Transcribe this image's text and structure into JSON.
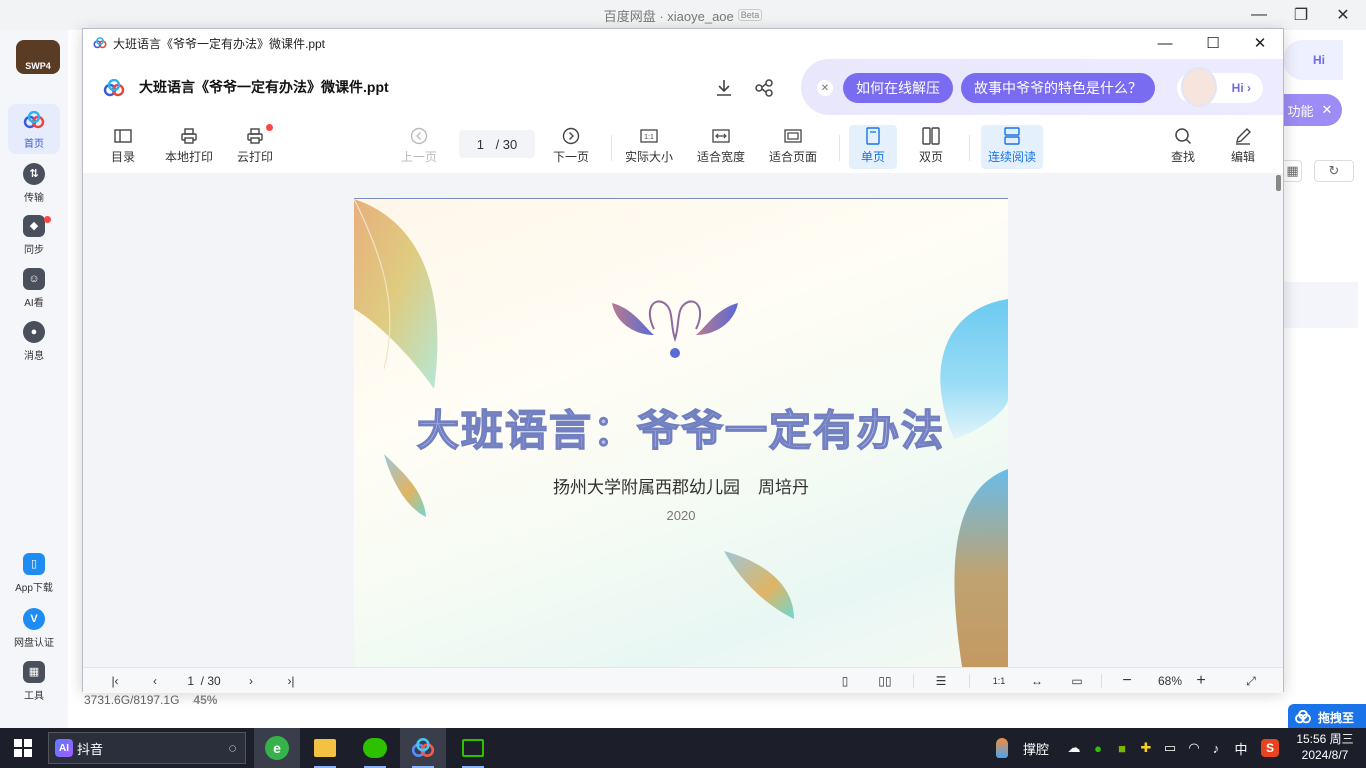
{
  "background_app": {
    "title": "百度网盘 · xiaoye_aoe",
    "beta_label": "Beta",
    "logo_text": "SWP4",
    "sidebar": [
      {
        "label": "首页",
        "icon": "cloud-icon"
      },
      {
        "label": "传输",
        "icon": "transfer-icon"
      },
      {
        "label": "同步",
        "icon": "sync-icon"
      },
      {
        "label": "AI看",
        "icon": "ai-watch-icon"
      },
      {
        "label": "消息",
        "icon": "message-icon"
      },
      {
        "label": "App下载",
        "icon": "phone-icon"
      },
      {
        "label": "网盘认证",
        "icon": "verify-icon"
      },
      {
        "label": "工具",
        "icon": "tools-icon"
      }
    ],
    "storage_text": "3731.6G/8197.1G",
    "storage_percent": "45%",
    "feature_pill_label": "功能",
    "hi_label": "Hi",
    "drag_pill_label": "拖拽至"
  },
  "viewer": {
    "window_title": "大班语言《爷爷一定有办法》微课件.ppt",
    "file_name": "大班语言《爷爷一定有办法》微课件.ppt",
    "ai_assistant": {
      "chips": [
        "如何在线解压",
        "故事中爷爷的特色是什么？"
      ],
      "hi_label": "Hi"
    },
    "toolbar": {
      "toc": "目录",
      "local_print": "本地打印",
      "cloud_print": "云打印",
      "prev_page": "上一页",
      "current_page": "1",
      "total_pages": "/ 30",
      "next_page": "下一页",
      "actual_size": "实际大小",
      "fit_width": "适合宽度",
      "fit_page": "适合页面",
      "single_page": "单页",
      "double_page": "双页",
      "continuous": "连续阅读",
      "find": "查找",
      "edit": "编辑"
    },
    "slide": {
      "title": "大班语言：爷爷一定有办法",
      "school": "扬州大学附属西郡幼儿园",
      "author": "周培丹",
      "year": "2020"
    },
    "statusbar": {
      "current_page": "1",
      "total_pages": "/ 30",
      "zoom": "68%",
      "zoom_out": "−",
      "zoom_in": "+"
    },
    "accent_color": "#1a73e8"
  },
  "taskbar": {
    "search_text": "抖音",
    "search_badge": "AI",
    "tray_app_label": "撑腔",
    "ime_label": "中",
    "time": "15:56 周三",
    "date": "2024/8/7"
  }
}
